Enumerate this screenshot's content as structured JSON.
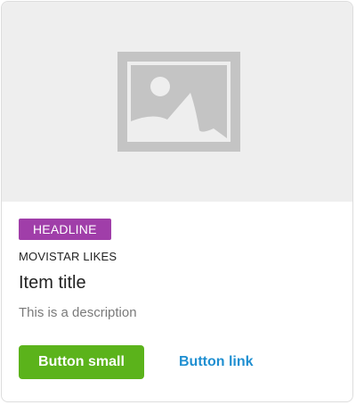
{
  "card": {
    "media_icon": "image-placeholder-icon",
    "headline_tag": "HEADLINE",
    "pretitle": "MOVISTAR LIKES",
    "title": "Item title",
    "description": "This is a description",
    "primary_button": "Button small",
    "link_button": "Button link"
  },
  "colors": {
    "tag_bg": "#a03ea9",
    "primary_button_bg": "#5bb31b",
    "link": "#1f8fd1",
    "media_bg": "#eeeeee",
    "placeholder_icon": "#c4c4c4"
  }
}
